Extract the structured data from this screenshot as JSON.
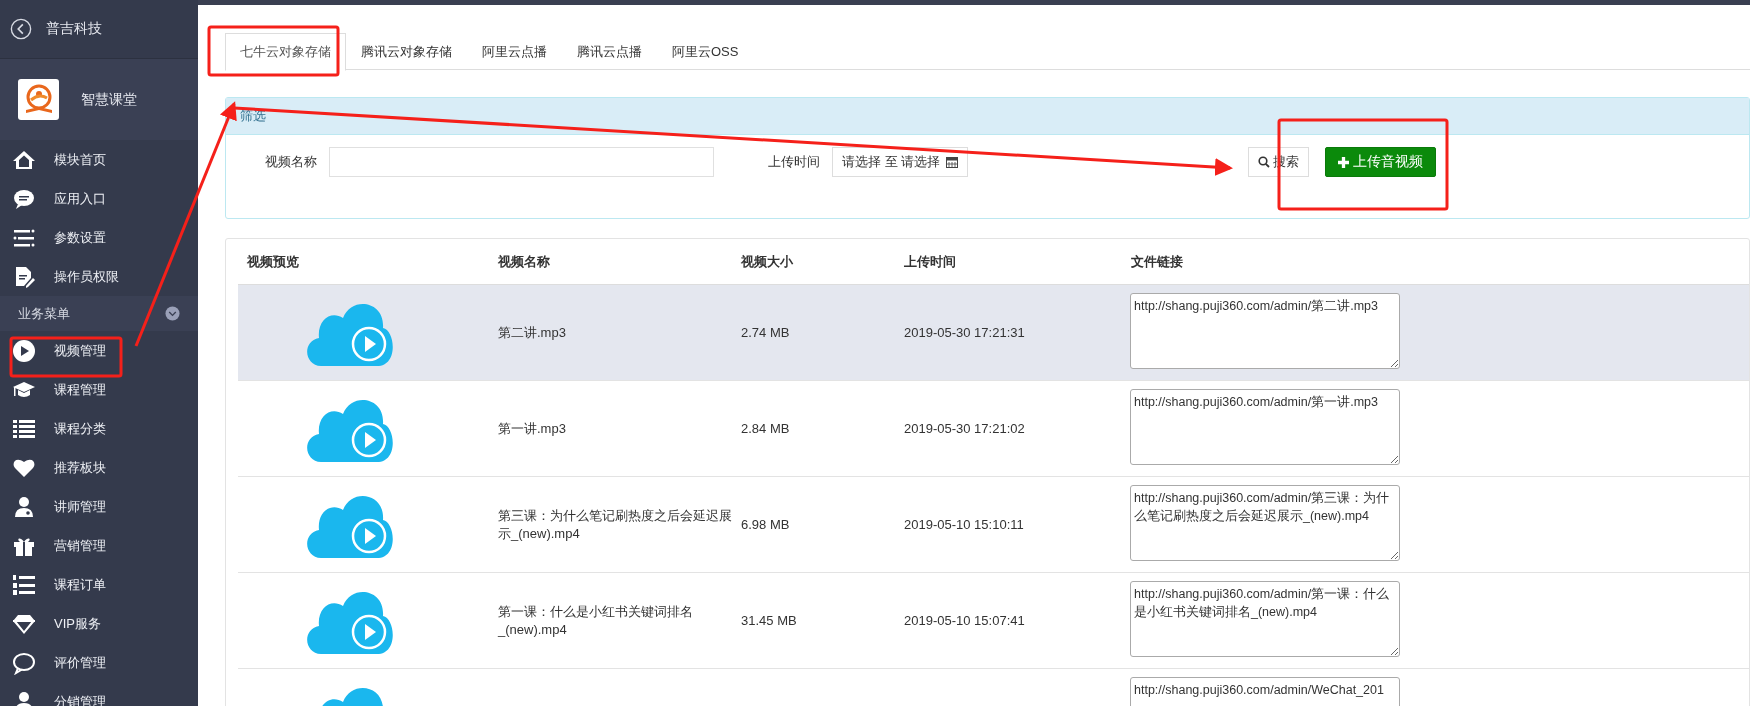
{
  "sidebar": {
    "back_label": "普吉科技",
    "app_name": "智慧课堂",
    "items": [
      {
        "label": "模块首页"
      },
      {
        "label": "应用入口"
      },
      {
        "label": "参数设置"
      },
      {
        "label": "操作员权限"
      }
    ],
    "group": {
      "label": "业务菜单",
      "expanded": true
    },
    "group_items": [
      {
        "label": "视频管理"
      },
      {
        "label": "课程管理"
      },
      {
        "label": "课程分类"
      },
      {
        "label": "推荐板块"
      },
      {
        "label": "讲师管理"
      },
      {
        "label": "营销管理"
      },
      {
        "label": "课程订单"
      },
      {
        "label": "VIP服务"
      },
      {
        "label": "评价管理"
      },
      {
        "label": "分销管理"
      }
    ]
  },
  "tabs": [
    {
      "label": "七牛云对象存储",
      "selected": true
    },
    {
      "label": "腾讯云对象存储",
      "selected": false
    },
    {
      "label": "阿里云点播",
      "selected": false
    },
    {
      "label": "腾讯云点播",
      "selected": false
    },
    {
      "label": "阿里云OSS",
      "selected": false
    }
  ],
  "filter": {
    "title": "筛选",
    "name_label": "视频名称",
    "time_label": "上传时间",
    "date_start": "请选择",
    "date_sep": "至",
    "date_end": "请选择",
    "search_button": "搜索",
    "upload_button": "上传音视频"
  },
  "table": {
    "columns": [
      "视频预览",
      "视频名称",
      "视频大小",
      "上传时间",
      "文件链接"
    ],
    "rows": [
      {
        "hovered": true,
        "name": "第二讲.mp3",
        "size": "2.74 MB",
        "time": "2019-05-30 17:21:31",
        "link": "http://shang.puji360.com/admin/第二讲.mp3"
      },
      {
        "hovered": false,
        "name": "第一讲.mp3",
        "size": "2.84 MB",
        "time": "2019-05-30 17:21:02",
        "link": "http://shang.puji360.com/admin/第一讲.mp3"
      },
      {
        "hovered": false,
        "name": "第三课：为什么笔记刷热度之后会延迟展示_(new).mp4",
        "size": "6.98 MB",
        "time": "2019-05-10 15:10:11",
        "link": "http://shang.puji360.com/admin/第三课：为什么笔记刷热度之后会延迟展示_(new).mp4"
      },
      {
        "hovered": false,
        "name": "第一课：什么是小红书关键词排名_(new).mp4",
        "size": "31.45 MB",
        "time": "2019-05-10 15:07:41",
        "link": "http://shang.puji360.com/admin/第一课：什么是小红书关键词排名_(new).mp4"
      },
      {
        "hovered": false,
        "link": "http://shang.puji360.com/admin/WeChat_201"
      }
    ]
  }
}
